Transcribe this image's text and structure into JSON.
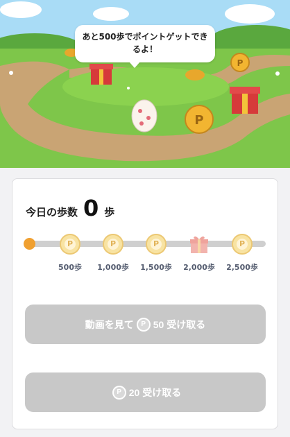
{
  "banner": {
    "message": "あと500歩でポイントゲットできるよ！"
  },
  "today": {
    "label": "今日の歩数",
    "value": "0",
    "unit": "歩"
  },
  "milestones": [
    {
      "label": "500歩",
      "reward": "coin-icon"
    },
    {
      "label": "1,000歩",
      "reward": "coin-icon"
    },
    {
      "label": "1,500歩",
      "reward": "coin-icon"
    },
    {
      "label": "2,000歩",
      "reward": "gift-icon"
    },
    {
      "label": "2,500歩",
      "reward": "coin-icon"
    }
  ],
  "progress": 0,
  "coin_symbol": "P",
  "buttons": {
    "video": {
      "prefix": "動画を見て",
      "amount": "50",
      "suffix": "受け取る"
    },
    "claim": {
      "amount": "20",
      "suffix": "受け取る"
    }
  },
  "colors": {
    "accent": "#f0a030",
    "button_disabled": "#c8c8c8",
    "coin": "#f8e3a2",
    "gift": "#f2b3ad"
  }
}
